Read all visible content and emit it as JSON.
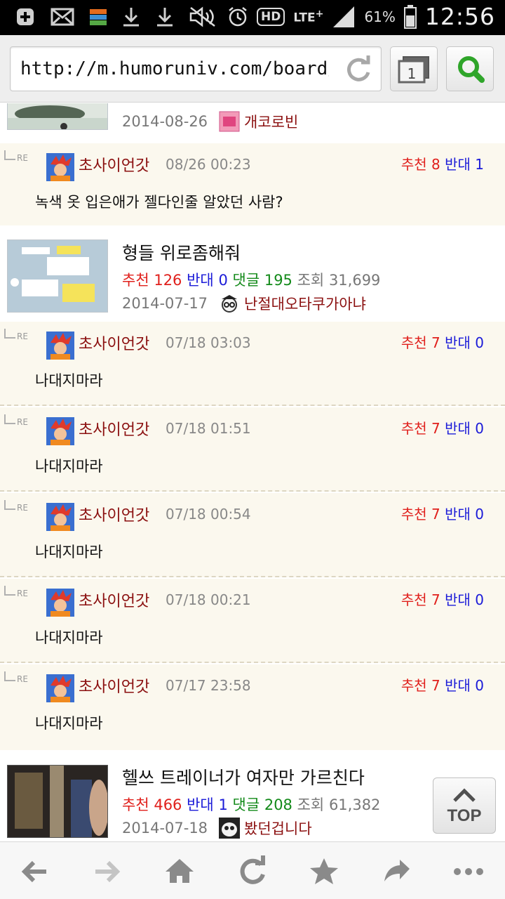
{
  "status_bar": {
    "time": "12:56",
    "battery_percent": "61%",
    "network": "LTE",
    "hd_label": "HD"
  },
  "address_bar": {
    "url": "http://m.humoruniv.com/board/c...",
    "tab_count": "1"
  },
  "posts": [
    {
      "date": "2014-08-26",
      "author": "개코로빈",
      "replies": [
        {
          "nick": "초사이언갓",
          "time": "08/26 00:23",
          "up_label": "추천",
          "up": "8",
          "down_label": "반대",
          "down": "1",
          "text": "녹색 옷 입은애가 젤다인줄 알았던 사람?"
        }
      ]
    },
    {
      "title": "형들 위로좀해줘",
      "up_label": "추천",
      "up": "126",
      "down_label": "반대",
      "down": "0",
      "comments_label": "댓글",
      "comments": "195",
      "views_label": "조회",
      "views": "31,699",
      "date": "2014-07-17",
      "author": "난절대오타쿠가아냐",
      "replies": [
        {
          "nick": "초사이언갓",
          "time": "07/18 03:03",
          "up_label": "추천",
          "up": "7",
          "down_label": "반대",
          "down": "0",
          "text": "나대지마라"
        },
        {
          "nick": "초사이언갓",
          "time": "07/18 01:51",
          "up_label": "추천",
          "up": "7",
          "down_label": "반대",
          "down": "0",
          "text": "나대지마라"
        },
        {
          "nick": "초사이언갓",
          "time": "07/18 00:54",
          "up_label": "추천",
          "up": "7",
          "down_label": "반대",
          "down": "0",
          "text": "나대지마라"
        },
        {
          "nick": "초사이언갓",
          "time": "07/18 00:21",
          "up_label": "추천",
          "up": "7",
          "down_label": "반대",
          "down": "0",
          "text": "나대지마라"
        },
        {
          "nick": "초사이언갓",
          "time": "07/17 23:58",
          "up_label": "추천",
          "up": "7",
          "down_label": "반대",
          "down": "0",
          "text": "나대지마라"
        }
      ]
    },
    {
      "title": "헬쓰 트레이너가 여자만 가르친다",
      "up_label": "추천",
      "up": "466",
      "down_label": "반대",
      "down": "1",
      "comments_label": "댓글",
      "comments": "208",
      "views_label": "조회",
      "views": "61,382",
      "date": "2014-07-18",
      "author": "봤던겁니다"
    }
  ],
  "reply_marker": "RE",
  "top_button": "TOP",
  "bottom_nav": [
    "back-icon",
    "forward-icon",
    "home-icon",
    "refresh-icon",
    "bookmark-star-icon",
    "share-icon",
    "more-icon"
  ],
  "colors": {
    "upvote": "#e0201c",
    "downvote": "#1b1bd8",
    "comments": "#138a1a",
    "nick": "#8b1010",
    "reply_bg": "#fbf8ee"
  }
}
